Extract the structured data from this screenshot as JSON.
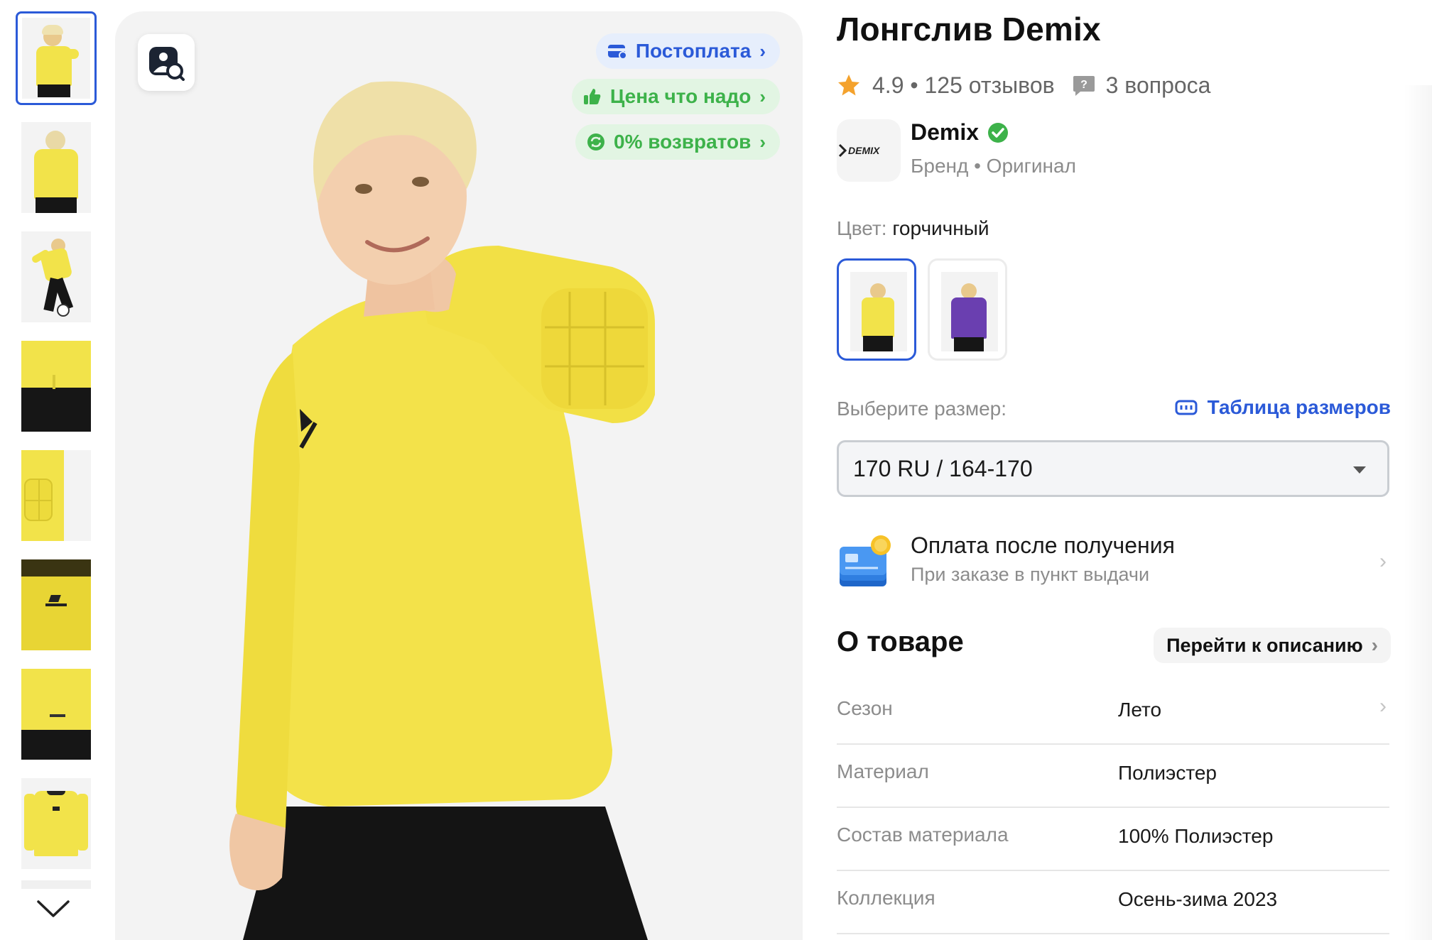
{
  "product": {
    "title": "Лонгслив Demix",
    "rating": "4.9",
    "rating_sep": " • ",
    "reviews": "125 отзывов",
    "questions": "3 вопроса"
  },
  "gallery": {
    "thumbnails": [
      {
        "id": "thumb-1"
      },
      {
        "id": "thumb-2"
      },
      {
        "id": "thumb-3"
      },
      {
        "id": "thumb-4"
      },
      {
        "id": "thumb-5"
      },
      {
        "id": "thumb-6"
      },
      {
        "id": "thumb-7"
      },
      {
        "id": "thumb-8"
      }
    ],
    "active_index": 0
  },
  "badges": {
    "postpay": "Постоплата",
    "price": "Цена что надо",
    "returns": "0% возвратов"
  },
  "brand": {
    "name": "Demix",
    "logo_text": "DEMIX",
    "subtitle": "Бренд • Оригинал"
  },
  "color": {
    "label": "Цвет: ",
    "value": "горчичный",
    "options": [
      "yellow",
      "purple"
    ]
  },
  "size": {
    "label": "Выберите размер:",
    "table_link": "Таблица размеров",
    "selected": "170 RU / 164-170"
  },
  "payment": {
    "title": "Оплата после получения",
    "subtitle": "При заказе в пункт выдачи"
  },
  "about": {
    "title": "О товаре",
    "link": "Перейти к описанию",
    "specs": [
      {
        "key": "Сезон",
        "value": "Лето"
      },
      {
        "key": "Материал",
        "value": "Полиэстер"
      },
      {
        "key": "Состав материала",
        "value": "100% Полиэстер"
      },
      {
        "key": "Коллекция",
        "value": "Осень-зима 2023"
      }
    ]
  },
  "colors": {
    "accent_blue": "#2b5ad8",
    "accent_green": "#3db24a",
    "shirt_yellow": "#f2e34a",
    "shirt_purple": "#6a3fb0",
    "star": "#f4a22d"
  }
}
